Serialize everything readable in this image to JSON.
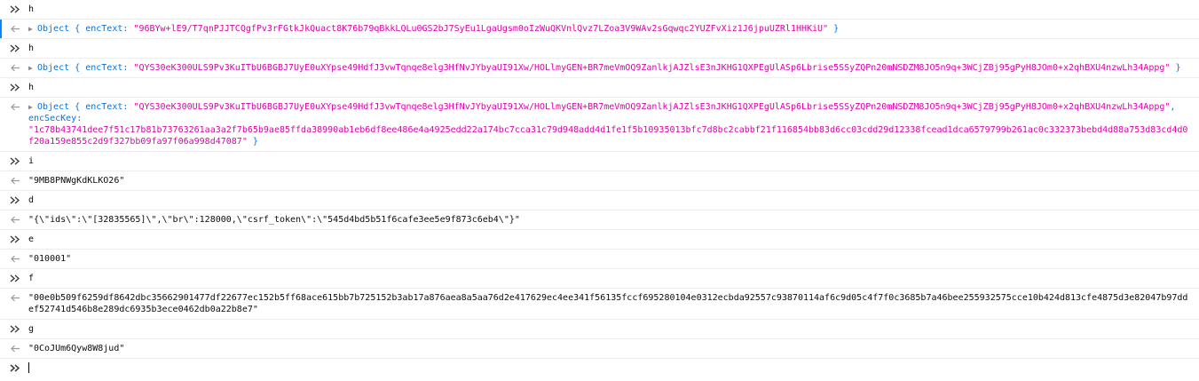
{
  "console": {
    "entries": [
      {
        "kind": "input",
        "text": "h"
      },
      {
        "kind": "output-object",
        "label": "Object",
        "key1": "encText",
        "val1": "\"96BYw+lE9/T7qnPJJTCQgfPv3rFGtkJkQuact8K76b79qBkkLQLu0GS2bJ7SyEu1LgaUgsm0oIzWuQKVnlQvz7LZoa3V9WAv2sGqwqc2YUZFvXiz1J6jpuUZRl1HHKiU\"",
        "close": "}"
      },
      {
        "kind": "input",
        "text": "h"
      },
      {
        "kind": "output-object",
        "label": "Object",
        "key1": "encText",
        "val1": "\"QYS30eK300ULS9Pv3KuITbU6BGBJ7UyE0uXYpse49HdfJ3vwTqnqe8elg3HfNvJYbyaUI91Xw/HOLlmyGEN+BR7meVmOQ9ZanlkjAJZlsE3nJKHG1QXPEgUlASp6Lbrise5SSyZQPn20mNSDZM8JO5n9q+3WCjZBj95gPyH8JOm0+x2qhBXU4nzwLh34Appg\"",
        "close": "}"
      },
      {
        "kind": "input",
        "text": "h"
      },
      {
        "kind": "output-object2",
        "label": "Object",
        "key1": "encText",
        "val1": "\"QYS30eK300ULS9Pv3KuITbU6BGBJ7UyE0uXYpse49HdfJ3vwTqnqe8elg3HfNvJYbyaUI91Xw/HOLlmyGEN+BR7meVmOQ9ZanlkjAJZlsE3nJKHG1QXPEgUlASp6Lbrise5SSyZQPn20mNSDZM8JO5n9q+3WCjZBj95gPyH8JOm0+x2qhBXU4nzwLh34Appg\"",
        "key2": "encSecKey",
        "val2": "\"1c78b43741dee7f51c17b81b73763261aa3a2f7b65b9ae85ffda38990ab1eb6df8ee486e4a4925edd22a174bc7cca31c79d948add4d1fe1f5b10935013bfc7d8bc2cabbf21f116854bb83d6cc03cdd29d12338fcead1dca6579799b261ac0c332373bebd4d88a753d83cd4d0f20a159e855c2d9f327bb09fa97f06a998d47087\"",
        "close": "}"
      },
      {
        "kind": "input",
        "text": "i"
      },
      {
        "kind": "output-string",
        "text": "\"9MB8PNWgKdKLKO26\""
      },
      {
        "kind": "input",
        "text": "d"
      },
      {
        "kind": "output-string",
        "text": "\"{\\\"ids\\\":\\\"[32835565]\\\",\\\"br\\\":128000,\\\"csrf_token\\\":\\\"545d4bd5b51f6cafe3ee5e9f873c6eb4\\\"}\""
      },
      {
        "kind": "input",
        "text": "e"
      },
      {
        "kind": "output-string",
        "text": "\"010001\""
      },
      {
        "kind": "input",
        "text": "f"
      },
      {
        "kind": "output-string",
        "text": "\"00e0b509f6259df8642dbc35662901477df22677ec152b5ff68ace615bb7b725152b3ab17a876aea8a5aa76d2e417629ec4ee341f56135fccf695280104e0312ecbda92557c93870114af6c9d05c4f7f0c3685b7a46bee255932575cce10b424d813cfe4875d3e82047b97ddef52741d546b8e289dc6935b3ece0462db0a22b8e7\""
      },
      {
        "kind": "input",
        "text": "g"
      },
      {
        "kind": "output-string",
        "text": "\"0CoJUm6Qyw8W8jud\""
      }
    ],
    "prompt_value": ""
  },
  "colors": {
    "input_arrow": "#3c3c3c",
    "output_arrow": "#9a9a9a",
    "object_label": "#0074e8",
    "object_string": "#dd00a9",
    "prompt_accent": "#0a84ff",
    "row_border": "#ededf0"
  },
  "icons": {
    "input": "double-chevron-right-icon",
    "output": "left-arrow-icon",
    "expand": "triangle-right-icon",
    "prompt": "double-chevron-right-icon"
  }
}
